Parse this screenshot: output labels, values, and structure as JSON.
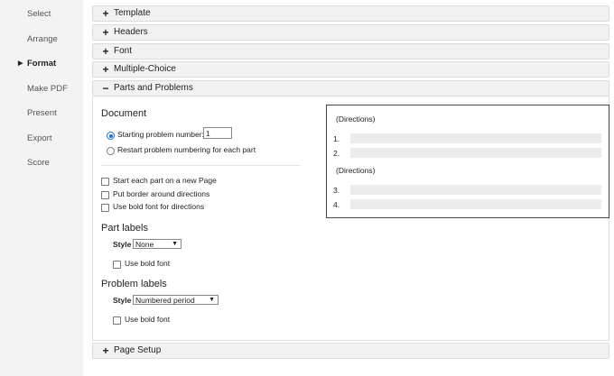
{
  "sidebar": {
    "items": [
      {
        "label": "Select"
      },
      {
        "label": "Arrange"
      },
      {
        "label": "Format",
        "active": true
      },
      {
        "label": "Make PDF"
      },
      {
        "label": "Present"
      },
      {
        "label": "Export"
      },
      {
        "label": "Score"
      }
    ]
  },
  "sections": {
    "template": {
      "sign": "+",
      "title": "Template"
    },
    "headers": {
      "sign": "+",
      "title": "Headers"
    },
    "font": {
      "sign": "+",
      "title": "Font"
    },
    "multiple_choice": {
      "sign": "+",
      "title": "Multiple-Choice"
    },
    "parts_problems": {
      "sign": "−",
      "title": "Parts and Problems"
    },
    "page_setup": {
      "sign": "+",
      "title": "Page Setup"
    }
  },
  "document": {
    "heading": "Document",
    "starting_label": "Starting problem number:",
    "starting_value": "1",
    "restart_label": "Restart problem numbering for each part",
    "new_page_label": "Start each part on a new Page",
    "border_label": "Put border around directions",
    "bold_directions_label": "Use bold font for directions"
  },
  "part_labels": {
    "heading": "Part labels",
    "style_label": "Style",
    "style_value": "None",
    "bold_label": "Use bold font"
  },
  "problem_labels": {
    "heading": "Problem labels",
    "style_label": "Style",
    "style_value": "Numbered period",
    "bold_label": "Use bold font"
  },
  "preview": {
    "directions1": "(Directions)",
    "n1": "1.",
    "n2": "2.",
    "directions2": "(Directions)",
    "n3": "3.",
    "n4": "4."
  }
}
